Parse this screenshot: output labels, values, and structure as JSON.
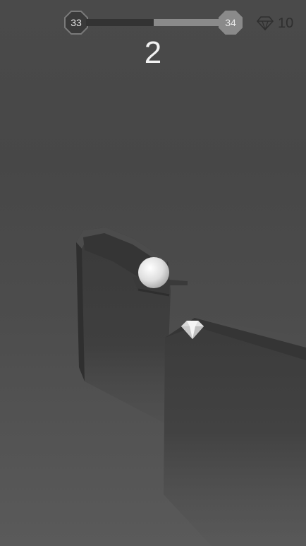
{
  "hud": {
    "current_level": "33",
    "next_level": "34",
    "level_progress": 0.5,
    "gem_count": "10",
    "score": "2"
  },
  "icons": {
    "gem": "diamond-icon",
    "level_badge": "octagon-badge"
  },
  "colors": {
    "background": "#4a4a4a",
    "progress_fill": "#8a8a8a",
    "progress_track": "#333333",
    "score_text": "#f2f2f2",
    "ball": "#e6e6e6"
  }
}
